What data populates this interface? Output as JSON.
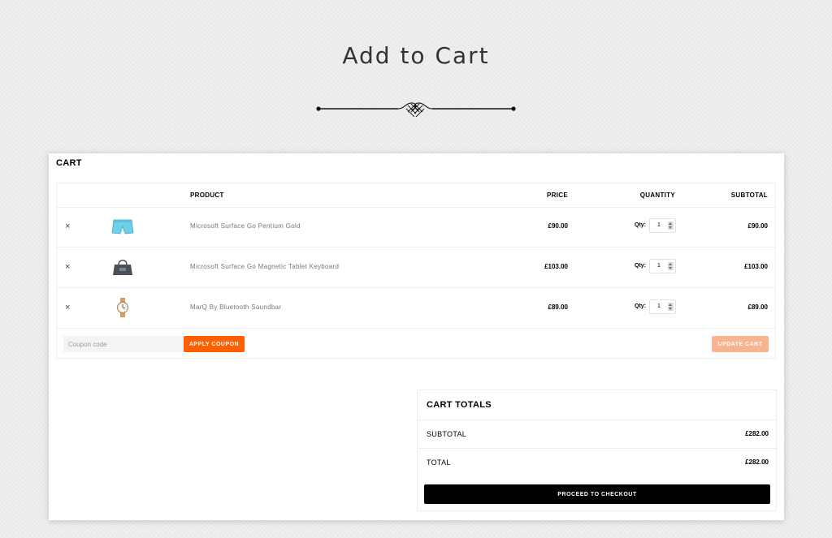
{
  "page": {
    "title": "Add to Cart"
  },
  "cart": {
    "heading": "CART",
    "columns": {
      "product": "PRODUCT",
      "price": "PRICE",
      "quantity": "QUANTITY",
      "subtotal": "SUBTOTAL"
    },
    "remove_symbol": "×",
    "qty_label": "Qty:",
    "items": [
      {
        "thumb_icon": "shorts-icon",
        "name": "Microsoft Surface Go Pentium Gold",
        "price": "£90.00",
        "qty": "1",
        "subtotal": "£90.00"
      },
      {
        "thumb_icon": "handbag-icon",
        "name": "Microsoft Surface Go Magnetic Tablet Keyboard",
        "price": "£103.00",
        "qty": "1",
        "subtotal": "£103.00"
      },
      {
        "thumb_icon": "wristwatch-icon",
        "name": "MarQ By Bluetooth Soundbar",
        "price": "£89.00",
        "qty": "1",
        "subtotal": "£89.00"
      }
    ],
    "coupon": {
      "placeholder": "Coupon code",
      "value": ""
    },
    "apply_coupon_label": "APPLY COUPON",
    "update_cart_label": "UPDATE CART"
  },
  "totals": {
    "title": "CART TOTALS",
    "subtotal_label": "SUBTOTAL",
    "subtotal_value": "£282.00",
    "total_label": "TOTAL",
    "total_value": "£282.00",
    "checkout_label": "PROCEED TO CHECKOUT"
  },
  "colors": {
    "accent": "#ff5f00",
    "update_button": "#f8b490",
    "checkout_button": "#000000",
    "background": "#efefef"
  }
}
